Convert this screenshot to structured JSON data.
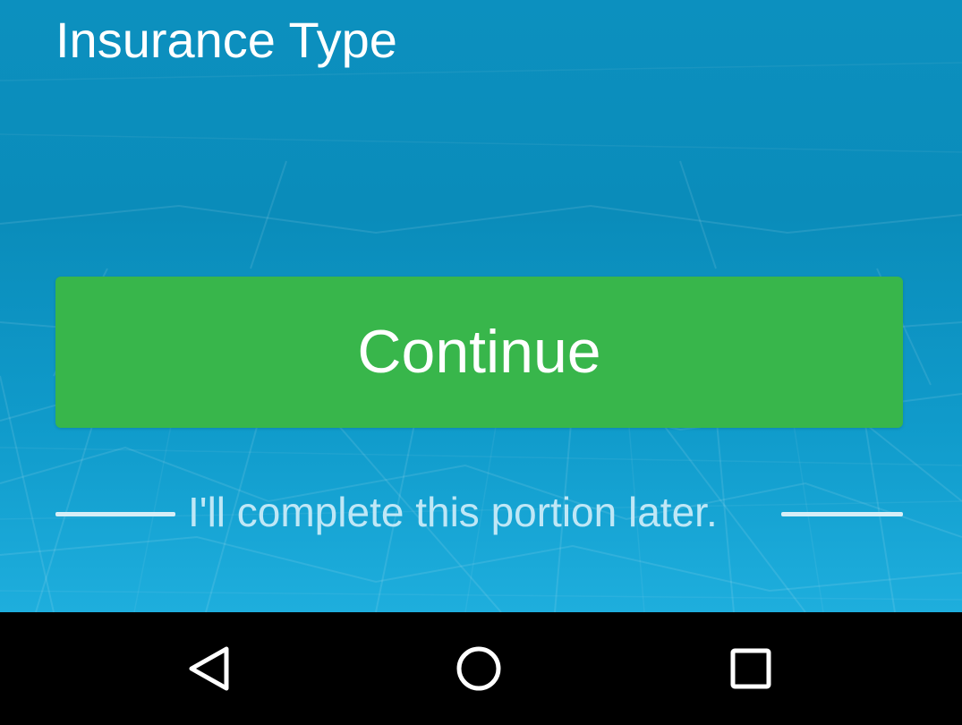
{
  "form": {
    "section_label": "Insurance Type",
    "continue_label": "Continue",
    "skip_label": "I'll complete this portion later."
  },
  "colors": {
    "background_top": "#0c90bf",
    "background_bottom": "#1eaedd",
    "button_green": "#38b64b",
    "skip_text": "#bfe7f6",
    "nav_bar": "#000000"
  },
  "system_nav": {
    "icons": [
      "back-icon",
      "home-icon",
      "recents-icon"
    ]
  }
}
